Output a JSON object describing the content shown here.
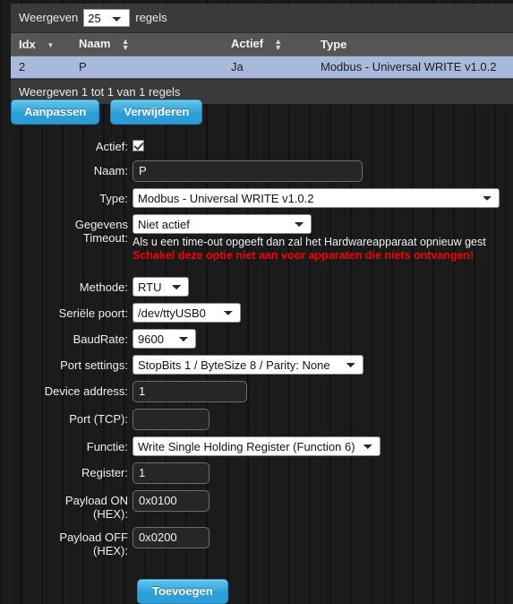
{
  "table": {
    "length_label_before": "Weergeven",
    "length_value": "25",
    "length_label_after": "regels",
    "columns": [
      {
        "label": "Idx",
        "sort": "desc"
      },
      {
        "label": "Naam",
        "sort": "both"
      },
      {
        "label": "Actief",
        "sort": "both"
      },
      {
        "label": "Type",
        "sort": "none"
      }
    ],
    "rows": [
      {
        "idx": "2",
        "naam": "P",
        "actief": "Ja",
        "type": "Modbus - Universal WRITE v1.0.2"
      }
    ],
    "info": "Weergeven 1 tot 1 van 1 regels"
  },
  "actions": {
    "edit_label": "Aanpassen",
    "delete_label": "Verwijderen"
  },
  "form": {
    "active": {
      "label": "Actief:",
      "checked": true
    },
    "name": {
      "label": "Naam:",
      "value": "P"
    },
    "type": {
      "label": "Type:",
      "value": "Modbus - Universal WRITE v1.0.2"
    },
    "timeout": {
      "label": "Gegevens\nTimeout:",
      "value": "Niet actief",
      "help": "Als u een time-out opgeeft dan zal het Hardwareapparaat opnieuw gest",
      "warning": "Schakel deze optie niet aan voor apparaten die niets ontvangen!"
    },
    "method": {
      "label": "Methode:",
      "value": "RTU"
    },
    "serial_port": {
      "label": "Seriële poort:",
      "value": "/dev/ttyUSB0"
    },
    "baudrate": {
      "label": "BaudRate:",
      "value": "9600"
    },
    "port_settings": {
      "label": "Port settings:",
      "value": "StopBits 1 / ByteSize 8 / Parity: None"
    },
    "device_address": {
      "label": "Device address:",
      "value": "1"
    },
    "port_tcp": {
      "label": "Port (TCP):",
      "value": ""
    },
    "function": {
      "label": "Functie:",
      "value": "Write Single Holding Register (Function 6)"
    },
    "register": {
      "label": "Register:",
      "value": "1"
    },
    "payload_on": {
      "label": "Payload ON\n(HEX):",
      "value": "0x0100"
    },
    "payload_off": {
      "label": "Payload OFF\n(HEX):",
      "value": "0x0200"
    },
    "submit_label": "Toevoegen"
  },
  "colors": {
    "accent_blue": "#2b9ed8",
    "row_selected": "#a9b9db",
    "warning_red": "#f40000",
    "header_gray": "#555555"
  }
}
